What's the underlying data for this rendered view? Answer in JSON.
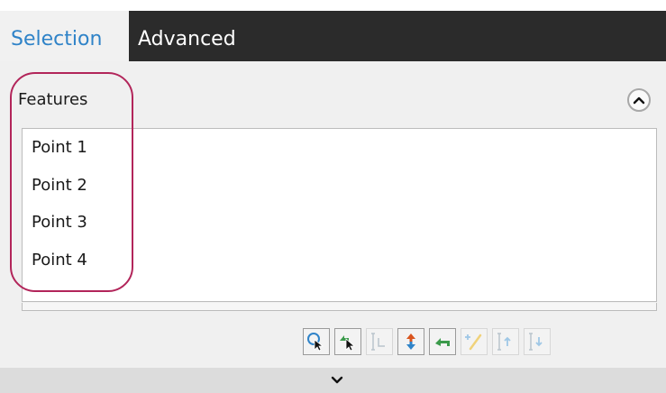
{
  "tabs": {
    "selection": "Selection",
    "advanced": "Advanced"
  },
  "features": {
    "label": "Features",
    "items": [
      "Point 1",
      "Point 2",
      "Point 3",
      "Point 4"
    ]
  },
  "icons": {
    "collapse": "chevron-up-icon",
    "expand": "chevron-down-icon",
    "toolbar": [
      {
        "name": "select-area-icon",
        "enabled": true
      },
      {
        "name": "select-back-icon",
        "enabled": true
      },
      {
        "name": "measure-icon",
        "enabled": false
      },
      {
        "name": "flip-direction-icon",
        "enabled": true
      },
      {
        "name": "undo-icon",
        "enabled": true
      },
      {
        "name": "add-line-icon",
        "enabled": false
      },
      {
        "name": "move-up-icon",
        "enabled": false
      },
      {
        "name": "move-down-icon",
        "enabled": false
      }
    ]
  },
  "colors": {
    "tab_active_text": "#2f83c8",
    "tab_bar": "#2b2b2b",
    "annotation": "#b2255a"
  }
}
